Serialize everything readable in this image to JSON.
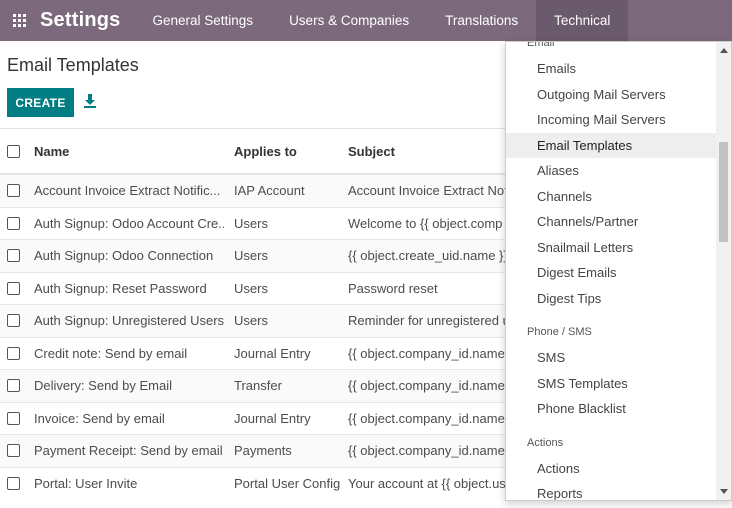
{
  "navbar": {
    "apps_icon": "apps-grid-icon",
    "brand": "Settings",
    "menus": [
      "General Settings",
      "Users & Companies",
      "Translations",
      "Technical"
    ],
    "active_menu": "Technical",
    "bg_color": "#7c6a7c"
  },
  "page": {
    "title": "Email Templates",
    "create_label": "CREATE",
    "download_icon": "download-icon",
    "accent_color": "#017e84"
  },
  "table": {
    "columns": [
      "Name",
      "Applies to",
      "Subject"
    ],
    "rows": [
      {
        "name": "Account Invoice Extract Notific...",
        "applies": "IAP Account",
        "subject": "Account Invoice Extract Not"
      },
      {
        "name": "Auth Signup: Odoo Account Cre...",
        "applies": "Users",
        "subject": "Welcome to {{ object.comp"
      },
      {
        "name": "Auth Signup: Odoo Connection",
        "applies": "Users",
        "subject": "{{ object.create_uid.name }}"
      },
      {
        "name": "Auth Signup: Reset Password",
        "applies": "Users",
        "subject": "Password reset"
      },
      {
        "name": "Auth Signup: Unregistered Users",
        "applies": "Users",
        "subject": "Reminder for unregistered u"
      },
      {
        "name": "Credit note: Send by email",
        "applies": "Journal Entry",
        "subject": "{{ object.company_id.name"
      },
      {
        "name": "Delivery: Send by Email",
        "applies": "Transfer",
        "subject": "{{ object.company_id.name"
      },
      {
        "name": "Invoice: Send by email",
        "applies": "Journal Entry",
        "subject": "{{ object.company_id.name"
      },
      {
        "name": "Payment Receipt: Send by email",
        "applies": "Payments",
        "subject": "{{ object.company_id.name"
      },
      {
        "name": "Portal: User Invite",
        "applies": "Portal User Config",
        "subject": "Your account at {{ object.us"
      }
    ]
  },
  "dropdown": {
    "sections": [
      {
        "header": "Email",
        "items": [
          "Emails",
          "Outgoing Mail Servers",
          "Incoming Mail Servers",
          "Email Templates",
          "Aliases",
          "Channels",
          "Channels/Partner",
          "Snailmail Letters",
          "Digest Emails",
          "Digest Tips"
        ]
      },
      {
        "header": "Phone / SMS",
        "items": [
          "SMS",
          "SMS Templates",
          "Phone Blacklist"
        ]
      },
      {
        "header": "Actions",
        "items": [
          "Actions",
          "Reports"
        ]
      }
    ],
    "active_item": "Email Templates"
  }
}
